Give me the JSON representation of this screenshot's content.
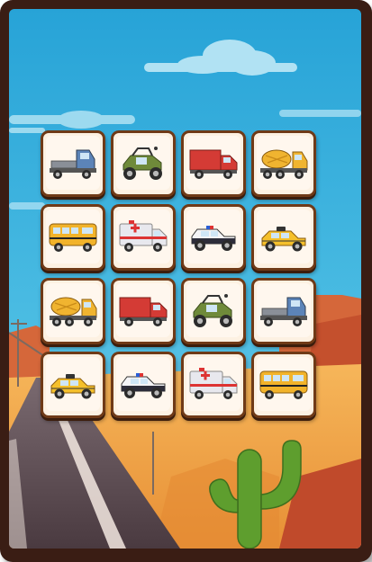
{
  "game": {
    "grid": {
      "rows": 4,
      "cols": 4
    },
    "cards": [
      {
        "vehicle": "flatbed-truck-icon",
        "color": "#5c84b8"
      },
      {
        "vehicle": "offroad-buggy-icon",
        "color": "#6f8a3a"
      },
      {
        "vehicle": "box-truck-icon",
        "color": "#d43b35"
      },
      {
        "vehicle": "cement-mixer-icon",
        "color": "#f0b430"
      },
      {
        "vehicle": "school-bus-icon",
        "color": "#f2b32a"
      },
      {
        "vehicle": "ambulance-icon",
        "color": "#e8e8ee"
      },
      {
        "vehicle": "police-car-icon",
        "color": "#2d2d3a"
      },
      {
        "vehicle": "taxi-icon",
        "color": "#f5c02b"
      },
      {
        "vehicle": "cement-mixer-icon",
        "color": "#f0b430"
      },
      {
        "vehicle": "box-truck-icon",
        "color": "#d43b35"
      },
      {
        "vehicle": "offroad-buggy-icon",
        "color": "#6f8a3a"
      },
      {
        "vehicle": "flatbed-truck-icon",
        "color": "#5c84b8"
      },
      {
        "vehicle": "taxi-icon",
        "color": "#f5c02b"
      },
      {
        "vehicle": "police-car-icon",
        "color": "#2d2d3a"
      },
      {
        "vehicle": "ambulance-icon",
        "color": "#e8e8ee"
      },
      {
        "vehicle": "school-bus-icon",
        "color": "#f2b32a"
      }
    ]
  },
  "background": {
    "theme": "desert-road",
    "sky_color": "#2fa6d8",
    "sand_color": "#f1a64a",
    "road_color": "#5b4a4e",
    "frame_color": "#3a1d14",
    "card_border_color": "#6f3a17",
    "card_face_color": "#fdf1e2"
  }
}
